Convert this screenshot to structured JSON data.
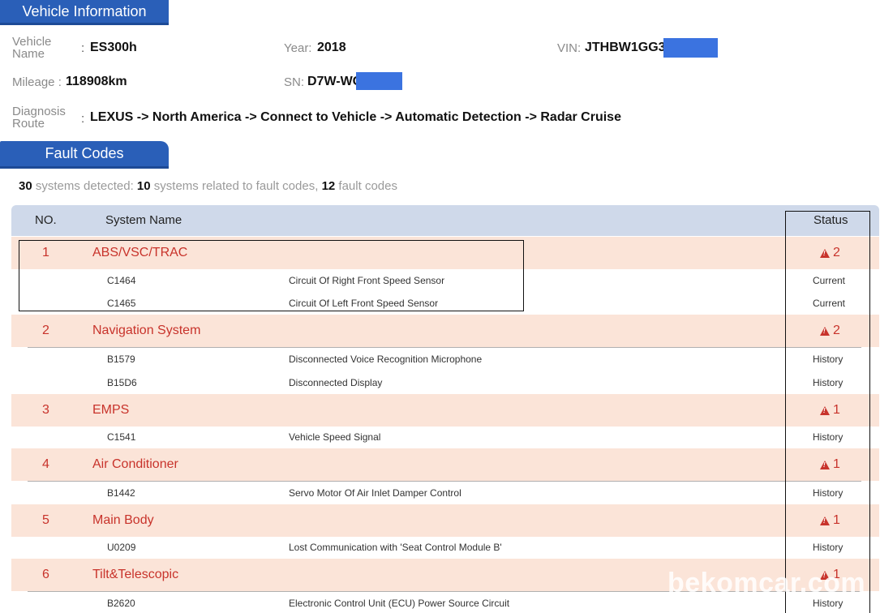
{
  "vehicle_section": {
    "title": "Vehicle Information",
    "name_label_1": "Vehicle",
    "name_label_2": "Name",
    "name_value": "ES300h",
    "year_label": "Year:",
    "year_value": "2018",
    "vin_label": "VIN:",
    "vin_value": "JTHBW1GG3J",
    "mileage_label": "Mileage :",
    "mileage_value": "118908km",
    "sn_label": "SN:",
    "sn_value": "D7W-WC",
    "route_label_1": "Diagnosis",
    "route_label_2": "Route",
    "route_value": "LEXUS -> North America -> Connect to Vehicle -> Automatic Detection -> Radar Cruise",
    "colon": ":"
  },
  "fault_section": {
    "title": "Fault Codes",
    "summary": {
      "systems_count": "30",
      "systems_text": "systems detected:",
      "related_count": "10",
      "related_text": "systems related to fault codes,",
      "codes_count": "12",
      "codes_text": "fault codes"
    },
    "headers": {
      "no": "NO.",
      "system": "System Name",
      "status": "Status"
    },
    "systems": [
      {
        "no": "1",
        "name": "ABS/VSC/TRAC",
        "count": "2",
        "codes": [
          {
            "code": "C1464",
            "desc": "Circuit Of Right Front Speed Sensor",
            "status": "Current"
          },
          {
            "code": "C1465",
            "desc": "Circuit Of Left Front Speed Sensor",
            "status": "Current"
          }
        ]
      },
      {
        "no": "2",
        "name": "Navigation System",
        "count": "2",
        "codes": [
          {
            "code": "B1579",
            "desc": "Disconnected Voice Recognition Microphone",
            "status": "History"
          },
          {
            "code": "B15D6",
            "desc": "Disconnected Display",
            "status": "History"
          }
        ]
      },
      {
        "no": "3",
        "name": "EMPS",
        "count": "1",
        "codes": [
          {
            "code": "C1541",
            "desc": "Vehicle Speed Signal",
            "status": "History"
          }
        ]
      },
      {
        "no": "4",
        "name": "Air Conditioner",
        "count": "1",
        "codes": [
          {
            "code": "B1442",
            "desc": "Servo Motor Of Air Inlet Damper Control",
            "status": "History"
          }
        ]
      },
      {
        "no": "5",
        "name": "Main Body",
        "count": "1",
        "codes": [
          {
            "code": "U0209",
            "desc": "Lost Communication with 'Seat Control Module B'",
            "status": "History"
          }
        ]
      },
      {
        "no": "6",
        "name": "Tilt&Telescopic",
        "count": "1",
        "codes": [
          {
            "code": "B2620",
            "desc": "Electronic Control Unit (ECU) Power Source Circuit",
            "status": "History"
          }
        ]
      }
    ]
  },
  "watermark": "bekomcar.com",
  "colors": {
    "tab_blue": "#2a5fb8",
    "header_bg": "#cfd9ea",
    "system_row_bg": "#fbe4d8",
    "system_red": "#c8332b"
  }
}
